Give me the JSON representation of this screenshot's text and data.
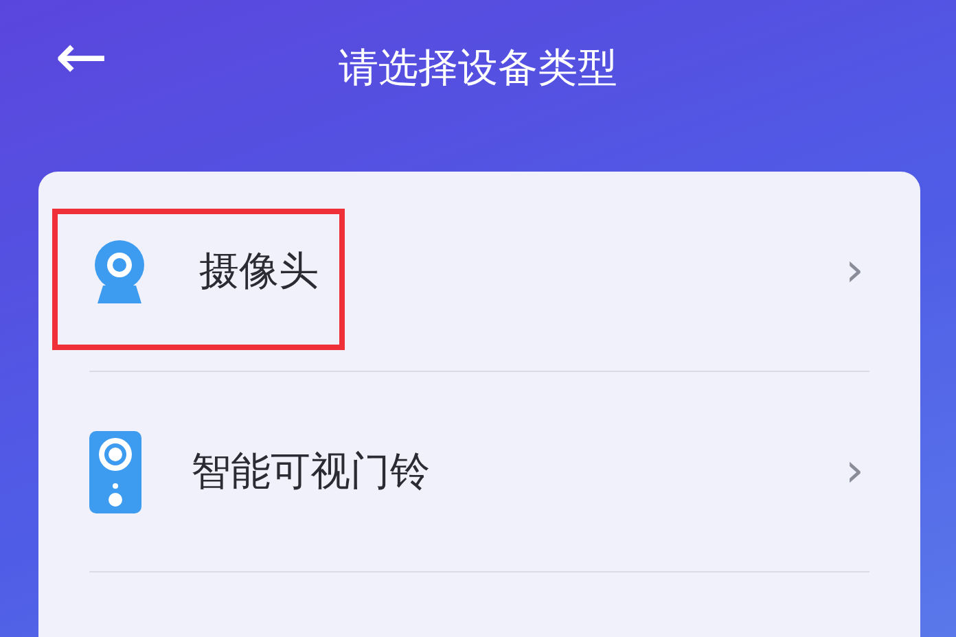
{
  "header": {
    "back": "←",
    "title": "请选择设备类型"
  },
  "devices": [
    {
      "kind": "camera",
      "label": "摄像头",
      "chevron": "›",
      "highlighted": true
    },
    {
      "kind": "doorbell",
      "label": "智能可视门铃",
      "chevron": "›",
      "highlighted": false
    }
  ]
}
